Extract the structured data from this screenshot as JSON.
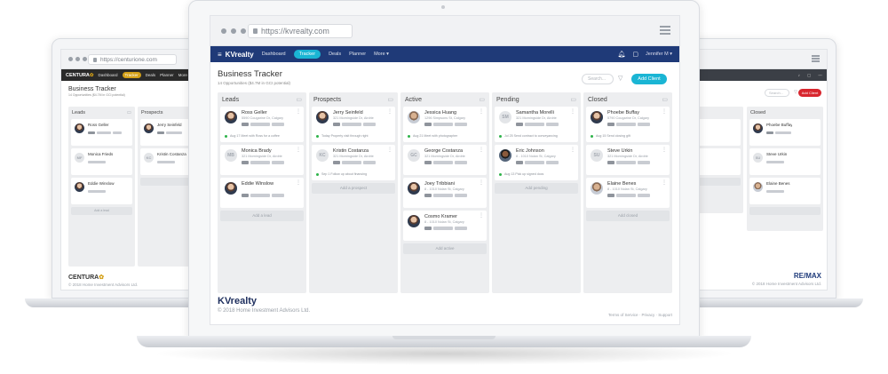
{
  "main": {
    "url": "https://kvrealty.com",
    "brand": "KVrealty",
    "nav": [
      "Dashboard",
      "Tracker",
      "Deals",
      "Planner",
      "More ▾"
    ],
    "active_nav": "Tracker",
    "user": "Jennifer M ▾",
    "page_title": "Business Tracker",
    "page_subtitle": "14 Opportunities ($4.7M in GCI potential)",
    "search_placeholder": "Search...",
    "add_client": "Add Client",
    "accent": "#1ab5d4",
    "nav_bg": "#1f3a78",
    "columns": [
      {
        "title": "Leads",
        "cards": [
          {
            "name": "Ross Geller",
            "addr": "5590 Cougarine Dr, Calgary",
            "avatar": "photo",
            "note": "Aug 17 Meet with Ross for a coffee"
          },
          {
            "name": "Monica Brady",
            "addr": "321 Morningside Dr, Airdrie",
            "avatar": "MB",
            "note": ""
          },
          {
            "name": "Eddie Winslow",
            "addr": "",
            "avatar": "photo",
            "note": ""
          }
        ],
        "add": "Add a lead"
      },
      {
        "title": "Prospects",
        "cards": [
          {
            "name": "Jerry Seinfeld",
            "addr": "321 Morningside Dr, Airdrie",
            "avatar": "photo",
            "note": "Today Property visit through right"
          },
          {
            "name": "Kristin Costanza",
            "addr": "321 Morningside Dr, Airdrie",
            "avatar": "KC",
            "note": "Sep 1 Follow up about financing"
          }
        ],
        "add": "Add a prospect"
      },
      {
        "title": "Active",
        "cards": [
          {
            "name": "Jessica Huang",
            "addr": "1296 Simpsons St, Calgary",
            "avatar": "photo2",
            "note": "Aug 21 Meet with photographer"
          },
          {
            "name": "George Costanza",
            "addr": "321 Morningside Dr, Airdrie",
            "avatar": "GC",
            "note": ""
          },
          {
            "name": "Joey Tribbiani",
            "addr": "8 - 1010 Nolan St, Calgary",
            "avatar": "photo",
            "note": ""
          },
          {
            "name": "Cosmo Kramer",
            "addr": "8 - 1010 Nolan St, Calgary",
            "avatar": "photo",
            "note": ""
          }
        ],
        "add": "Add active"
      },
      {
        "title": "Pending",
        "cards": [
          {
            "name": "Samantha Morelli",
            "addr": "321 Morningside Dr, Airdrie",
            "avatar": "SM",
            "note": "Jul 25 Send contract to conveyancing"
          },
          {
            "name": "Eric Johnson",
            "addr": "8 - 1010 Nolan St, Calgary",
            "avatar": "photo3",
            "note": "Aug 13 Pick up signed docs"
          }
        ],
        "add": "Add pending"
      },
      {
        "title": "Closed",
        "cards": [
          {
            "name": "Phoebe Buffay",
            "addr": "5790 Cougarine Dr, Calgary",
            "avatar": "photo",
            "note": "Aug 15 Send closing gift"
          },
          {
            "name": "Steve Urkin",
            "addr": "321 Morningside Dr, Airdrie",
            "avatar": "SU",
            "note": ""
          },
          {
            "name": "Elaine Benes",
            "addr": "8 - 1010 Nolan St, Calgary",
            "avatar": "photo2",
            "note": ""
          }
        ],
        "add": "Add closed"
      }
    ],
    "footer_logo": "KVrealty",
    "footer_copy": "© 2018 Home Investment Advisors Ltd.",
    "footer_links": "Terms of Service · Privacy · Support"
  },
  "left": {
    "url": "https://centurione.com",
    "brand": "CENTURA",
    "nav": [
      "Dashboard",
      "Tracker",
      "Deals",
      "Planner",
      "More ▾"
    ],
    "active_nav": "Tracker",
    "accent": "#d4a017",
    "nav_bg": "#2a2a2a",
    "page_title": "Business Tracker",
    "page_subtitle": "14 Opportunities ($4.7M in GCI potential)",
    "columns": [
      "Leads",
      "Prospects"
    ],
    "cards": [
      "Ross Geller",
      "Monica Frieds",
      "Eddie Winslow",
      "Jerry Seinfeld",
      "Kristin Costanza"
    ],
    "add": "Add a lead",
    "footer_logo": "CENTURA",
    "footer_copy": "© 2018 Home Investment Advisors Ltd."
  },
  "right": {
    "nav_bg": "#3b3f46",
    "columns": [
      "",
      "Closed"
    ],
    "cards": [
      "Phoebe Buffay",
      "Steve Urkin",
      "Elaine Benes"
    ],
    "add_client": "Add Client",
    "search_placeholder": "Search...",
    "footer_logo": "RE/MAX",
    "footer_copy": "© 2018 Home Investment Advisors Ltd.",
    "accent": "#d8262e"
  }
}
